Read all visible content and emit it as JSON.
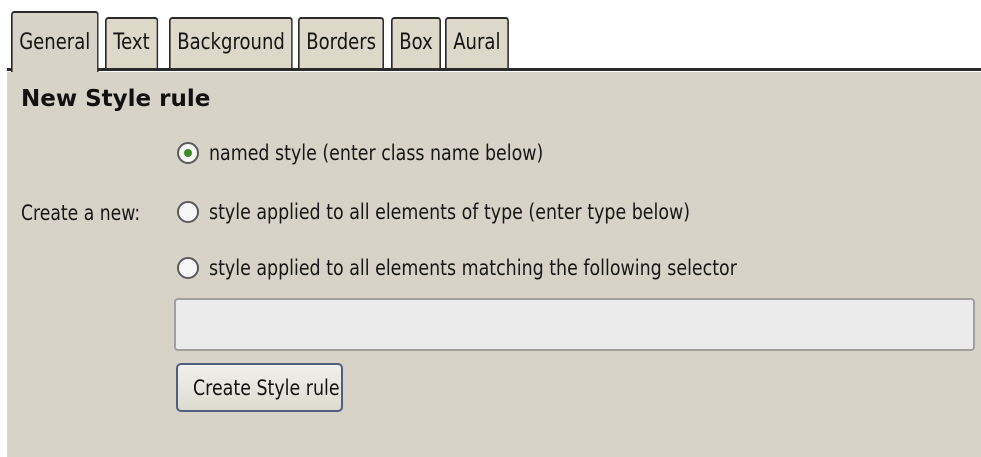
{
  "tabs": [
    {
      "label": "General",
      "active": true
    },
    {
      "label": "Text",
      "active": false
    },
    {
      "label": "Background",
      "active": false
    },
    {
      "label": "Borders",
      "active": false
    },
    {
      "label": "Box",
      "active": false
    },
    {
      "label": "Aural",
      "active": false
    }
  ],
  "form": {
    "title": "New Style rule",
    "create_label": "Create a new:",
    "options": [
      {
        "label": "named style (enter class name below)",
        "checked": true
      },
      {
        "label": "style applied to all elements of type (enter type below)",
        "checked": false
      },
      {
        "label": "style applied to all elements matching the following selector",
        "checked": false
      }
    ],
    "input_value": "",
    "input_placeholder": "",
    "button_label": "Create Style rule"
  },
  "colors": {
    "panel_background": "#d7d4c7",
    "radio_selected_dot": "#3f8a27",
    "button_border": "#4e5f80"
  }
}
